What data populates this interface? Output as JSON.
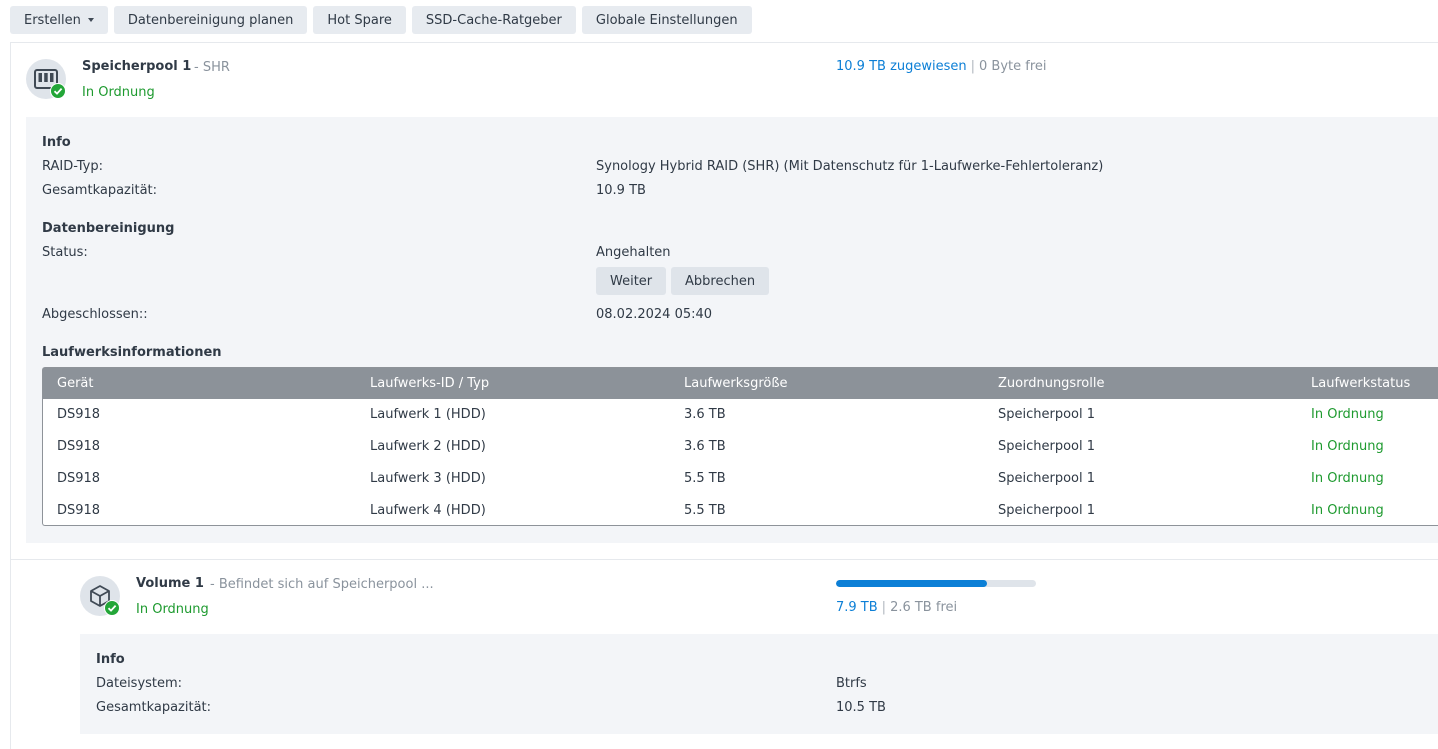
{
  "toolbar": {
    "create": "Erstellen",
    "schedule": "Datenbereinigung planen",
    "hot_spare": "Hot Spare",
    "ssd_cache": "SSD-Cache-Ratgeber",
    "global": "Globale Einstellungen"
  },
  "pool": {
    "name": "Speicherpool 1",
    "type_suffix": "- SHR",
    "status": "In Ordnung",
    "allocated": "10.9 TB zugewiesen",
    "separator": "|",
    "free": "0 Byte frei",
    "info_title": "Info",
    "raid_label": "RAID-Typ:",
    "raid_value": "Synology Hybrid RAID (SHR) (Mit Datenschutz für 1-Laufwerke-Fehlertoleranz)",
    "capacity_label": "Gesamtkapazität:",
    "capacity_value": "10.9 TB",
    "scrub_title": "Datenbereinigung",
    "scrub_status_label": "Status:",
    "scrub_status_value": "Angehalten",
    "resume_button": "Weiter",
    "cancel_button": "Abbrechen",
    "completed_label": "Abgeschlossen::",
    "completed_value": "08.02.2024 05:40",
    "drives_title": "Laufwerksinformationen",
    "status_color": "#1e9a2f",
    "accent_color": "#0c7fd6"
  },
  "drives_table": {
    "headers": [
      "Gerät",
      "Laufwerks-ID / Typ",
      "Laufwerksgröße",
      "Zuordnungsrolle",
      "Laufwerkstatus"
    ],
    "rows": [
      [
        "DS918",
        "Laufwerk 1 (HDD)",
        "3.6 TB",
        "Speicherpool 1",
        "In Ordnung"
      ],
      [
        "DS918",
        "Laufwerk 2 (HDD)",
        "3.6 TB",
        "Speicherpool 1",
        "In Ordnung"
      ],
      [
        "DS918",
        "Laufwerk 3 (HDD)",
        "5.5 TB",
        "Speicherpool 1",
        "In Ordnung"
      ],
      [
        "DS918",
        "Laufwerk 4 (HDD)",
        "5.5 TB",
        "Speicherpool 1",
        "In Ordnung"
      ]
    ]
  },
  "volume": {
    "name": "Volume 1",
    "location": "- Befindet sich auf Speicherpool ...",
    "status": "In Ordnung",
    "used": "7.9 TB",
    "separator": "|",
    "free": "2.6 TB frei",
    "usage_fraction": 0.755,
    "info_title": "Info",
    "fs_label": "Dateisystem:",
    "fs_value": "Btrfs",
    "capacity_label": "Gesamtkapazität:",
    "capacity_value": "10.5 TB"
  },
  "icons": {
    "pool": "storage-pool-icon",
    "volume": "volume-cube-icon",
    "ok": "check-badge-icon",
    "dropdown": "caret-down-icon"
  }
}
